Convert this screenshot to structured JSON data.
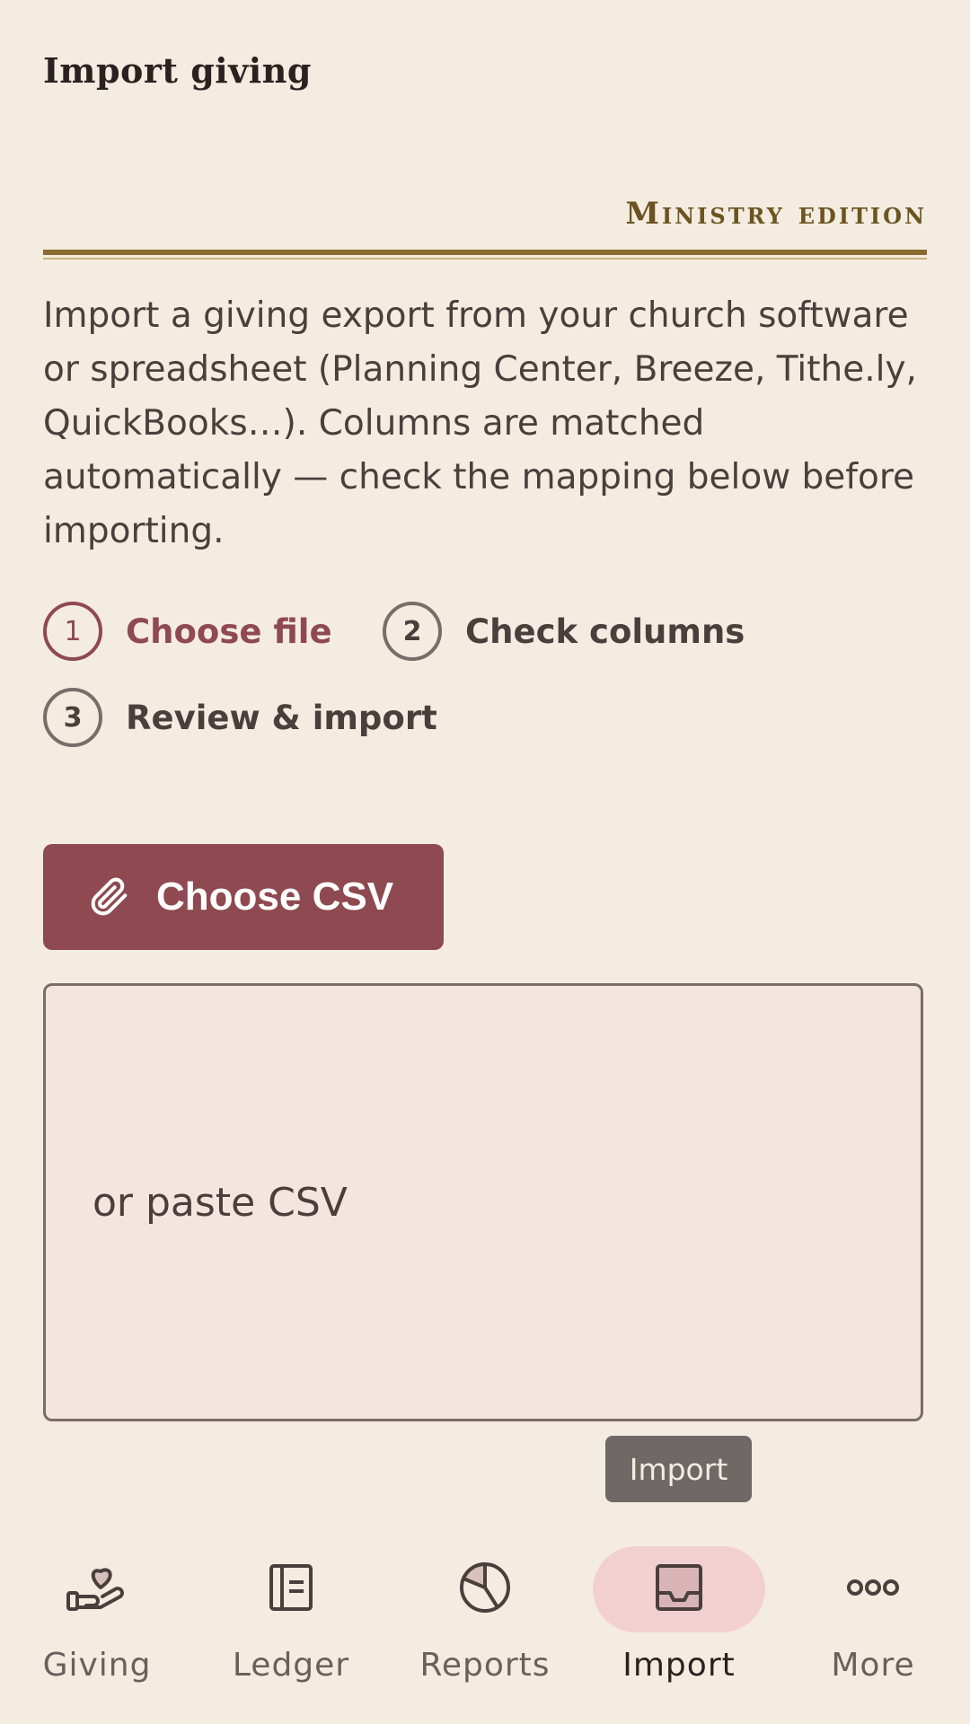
{
  "header": {
    "title": "Import giving",
    "edition": "Ministry edition"
  },
  "intro": "Import a giving export from your church software or spreadsheet (Planning Center, Breeze, Tithe.ly, QuickBooks…). Columns are matched automatically — check the mapping below before importing.",
  "steps": [
    {
      "number": "1",
      "label": "Choose file",
      "active": true
    },
    {
      "number": "2",
      "label": "Check columns",
      "active": false
    },
    {
      "number": "3",
      "label": "Review & import",
      "active": false
    }
  ],
  "choose_button": {
    "label": "Choose CSV",
    "icon": "paperclip-icon"
  },
  "paste_box": {
    "placeholder": "or paste CSV"
  },
  "tooltip": "Import",
  "nav": {
    "items": [
      {
        "label": "Giving",
        "icon": "heart-hand-icon",
        "active": false
      },
      {
        "label": "Ledger",
        "icon": "ledger-icon",
        "active": false
      },
      {
        "label": "Reports",
        "icon": "pie-chart-icon",
        "active": false
      },
      {
        "label": "Import",
        "icon": "inbox-tray-icon",
        "active": true
      },
      {
        "label": "More",
        "icon": "more-dots-icon",
        "active": false
      }
    ]
  },
  "colors": {
    "accent": "#8e4a50",
    "background": "#f5ece1",
    "gold": "#8a6a30",
    "active_nav": "#f2d0d2"
  }
}
